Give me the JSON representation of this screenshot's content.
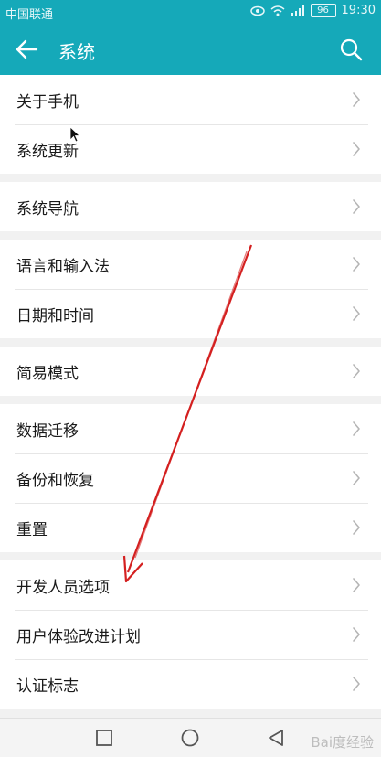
{
  "status_bar": {
    "carrier": "中国联通",
    "battery": "96",
    "time": "19:30",
    "icons": [
      "eye-icon",
      "wifi-icon",
      "signal-icon",
      "battery-icon"
    ]
  },
  "app_bar": {
    "title": "系统",
    "color": "#15a9b9",
    "icons": [
      "back-arrow-icon",
      "search-icon"
    ]
  },
  "settings_groups": [
    {
      "items": [
        "关于手机",
        "系统更新"
      ]
    },
    {
      "items": [
        "系统导航"
      ]
    },
    {
      "items": [
        "语言和输入法",
        "日期和时间"
      ]
    },
    {
      "items": [
        "简易模式"
      ]
    },
    {
      "items": [
        "数据迁移",
        "备份和恢复",
        "重置"
      ]
    },
    {
      "items": [
        "开发人员选项",
        "用户体验改进计划",
        "认证标志"
      ]
    }
  ],
  "annotation": {
    "color": "#d42020",
    "icon": "red-arrow-annotation"
  },
  "nav_bar": {
    "icons": [
      "recents-square-icon",
      "home-circle-icon",
      "back-triangle-icon"
    ]
  },
  "watermark": {
    "text": "Bai度经验"
  }
}
